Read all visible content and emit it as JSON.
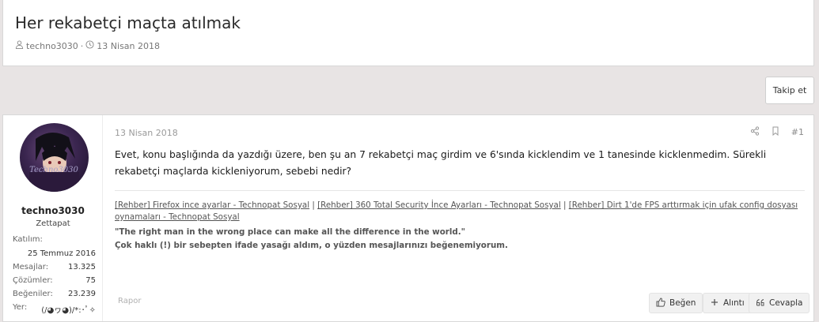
{
  "thread": {
    "title": "Her rekabetçi maçta atılmak",
    "author": "techno3030",
    "separator": "·",
    "date": "13 Nisan 2018"
  },
  "follow_button": "Takip et",
  "post": {
    "date": "13 Nisan 2018",
    "number": "#1",
    "body": "Evet, konu başlığında da yazdığı üzere, ben şu an 7 rekabetçi maç girdim ve 6'sında kicklendim ve 1 tanesinde kicklenmedim. Sürekli rekabetçi maçlarda kickleniyorum, sebebi nedir?",
    "report": "Rapor"
  },
  "user": {
    "avatar_text": "Techno3030",
    "name": "techno3030",
    "title": "Zettapat",
    "joined_label": "Katılım:",
    "joined_value": "25 Temmuz 2016",
    "messages_label": "Mesajlar:",
    "messages_value": "13.325",
    "solutions_label": "Çözümler:",
    "solutions_value": "75",
    "likes_label": "Beğeniler:",
    "likes_value": "23.239",
    "location_label": "Yer:",
    "location_value": "(/◕ヮ◕)/*:･ﾟ✧"
  },
  "signature": {
    "link1": "[Rehber] Firefox ince ayarlar - Technopat Sosyal",
    "sep": " | ",
    "link2": "[Rehber] 360 Total Security İnce Ayarları - Technopat Sosyal",
    "link3": "[Rehber] Dirt 1'de FPS arttırmak için ufak config dosyası oynamaları - Technopat Sosyal",
    "quote": "\"The right man in the wrong place can make all the difference in the world.\"",
    "note": "Çok haklı (!) bir sebepten ifade yasağı aldım, o yüzden mesajlarınızı beğenemiyorum."
  },
  "buttons": {
    "like": "Beğen",
    "quote": "Alıntı",
    "reply": "Cevapla"
  },
  "icons": [
    "user-icon",
    "clock-icon",
    "share-icon",
    "bookmark-icon",
    "thumbs-up-icon",
    "plus-icon",
    "reply-quote-icon"
  ]
}
